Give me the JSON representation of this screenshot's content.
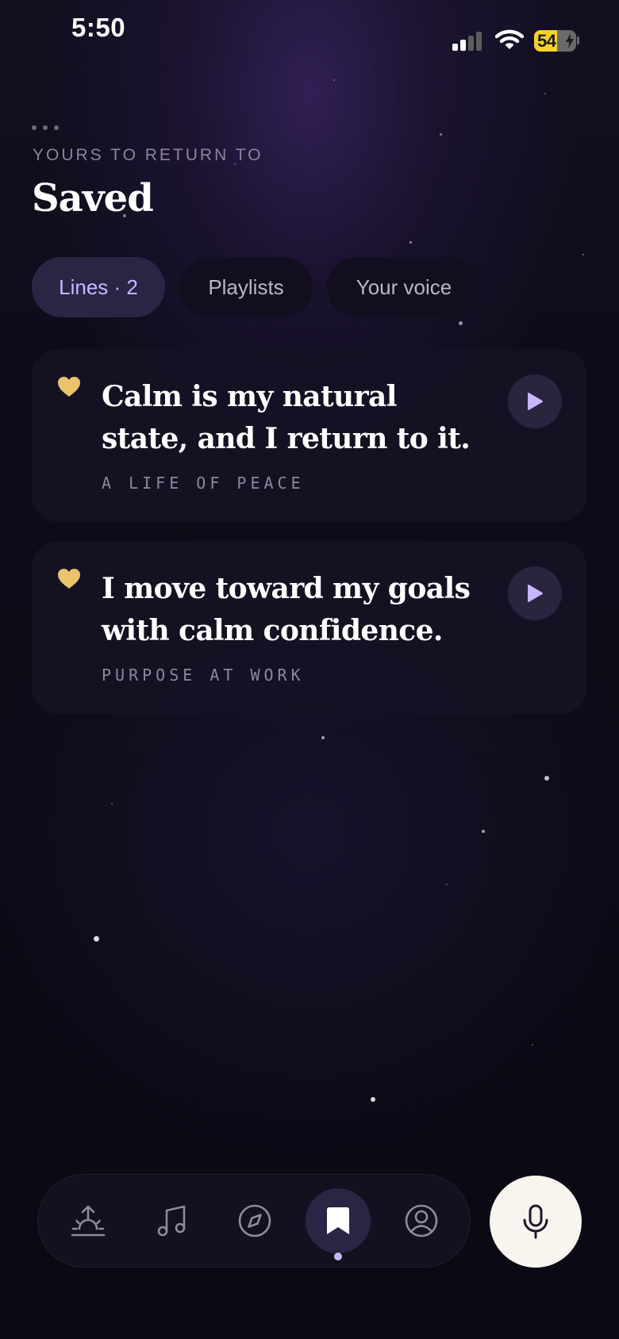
{
  "status_bar": {
    "time": "5:50",
    "battery_percent": "54",
    "signal_bars_active": 2,
    "signal_bars_total": 4,
    "icons": [
      "cellular-signal-icon",
      "wifi-icon",
      "battery-charging-icon"
    ]
  },
  "header": {
    "eyebrow": "YOURS TO RETURN TO",
    "title": "Saved"
  },
  "tabs": [
    {
      "label": "Lines · 2",
      "active": true
    },
    {
      "label": "Playlists",
      "active": false
    },
    {
      "label": "Your voice",
      "active": false
    }
  ],
  "saved_lines": [
    {
      "text": "Calm is my natural state, and I return to it.",
      "collection": "A LIFE OF PEACE",
      "icons": [
        "heart-icon",
        "play-icon"
      ]
    },
    {
      "text": "I move toward my goals with calm confidence.",
      "collection": "PURPOSE AT WORK",
      "icons": [
        "heart-icon",
        "play-icon"
      ]
    }
  ],
  "bottom_nav": {
    "items": [
      {
        "icon": "sunrise-icon",
        "active": false
      },
      {
        "icon": "music-note-icon",
        "active": false
      },
      {
        "icon": "compass-icon",
        "active": false
      },
      {
        "icon": "bookmark-icon",
        "active": true
      },
      {
        "icon": "profile-icon",
        "active": false
      }
    ],
    "mic_icon": "microphone-icon"
  },
  "colors": {
    "background": "#0b0913",
    "accent": "#c8b7ff",
    "heart": "#e9c46a",
    "card": "#161224",
    "mic_button": "#f8f5ef"
  }
}
